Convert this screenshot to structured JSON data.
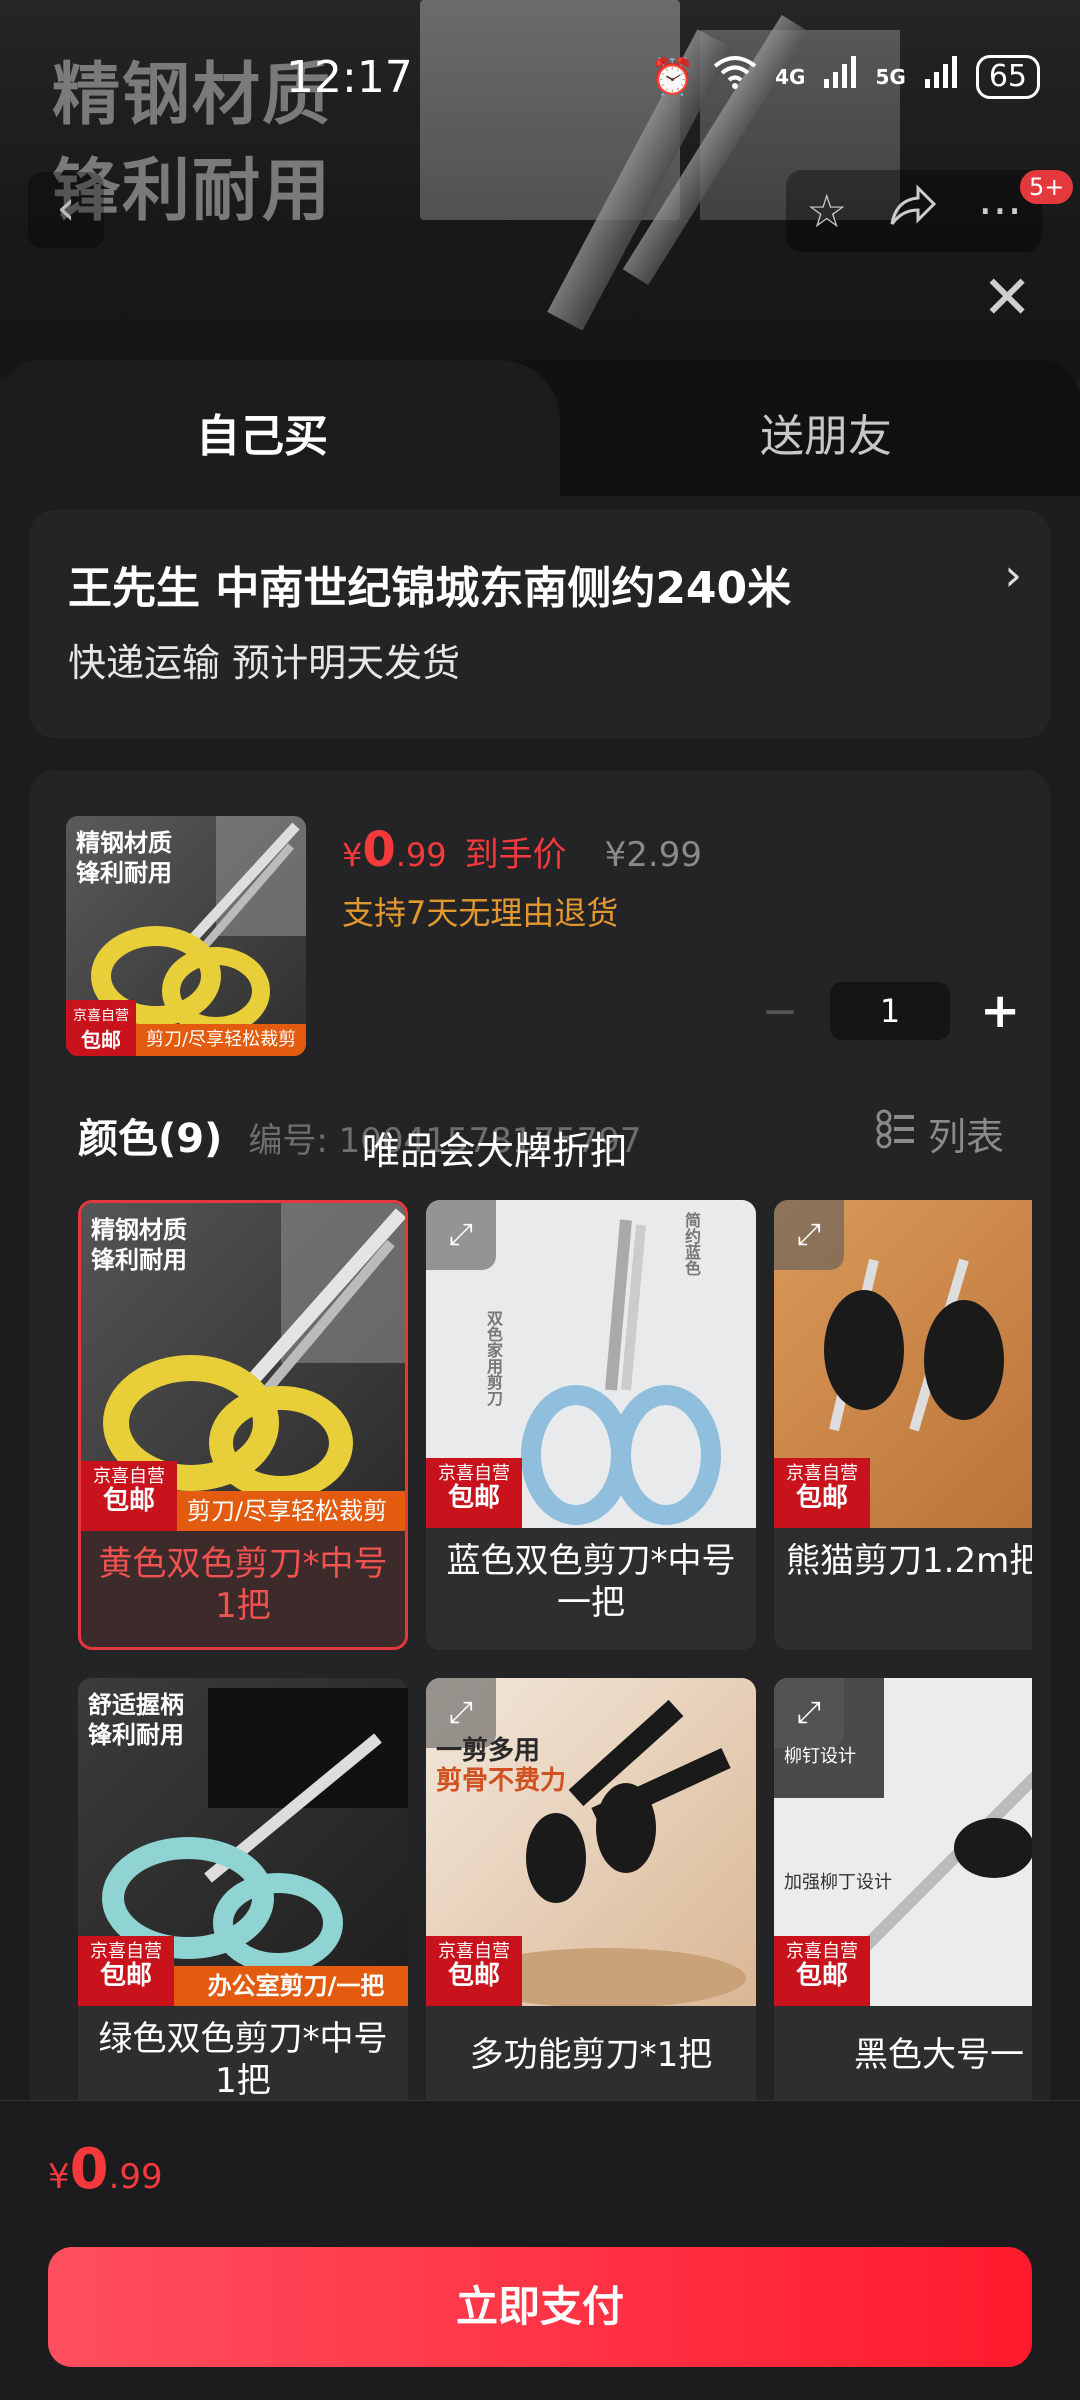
{
  "status_bar": {
    "time": "12:17",
    "network_1": "4G",
    "network_2": "5G",
    "battery": "65"
  },
  "hero": {
    "title_line1": "精钢材质",
    "title_line2": "锋利耐用",
    "badge": "5+"
  },
  "tabs": {
    "self": "自己买",
    "friend": "送朋友"
  },
  "address": {
    "line1": "王先生  中南世纪锦城东南侧约240米",
    "line2": "快递运输 预计明天发货"
  },
  "product": {
    "price_currency": "¥",
    "price_int": "0",
    "price_dec": ".99",
    "price_tag": "到手价",
    "orig_price": "¥2.99",
    "return_note": "支持7天无理由退货",
    "thumb_caption1": "精钢材质",
    "thumb_caption2": "锋利耐用",
    "thumb_strip": "剪刀/尽享轻松裁剪",
    "quantity": "1",
    "qty_minus": "−",
    "qty_plus": "+"
  },
  "color_section": {
    "title": "颜色(9)",
    "code_label": "编号: 10041578175797",
    "list_toggle": "列表",
    "overlay_toast": "唯品会大牌折扣"
  },
  "jd_badge": {
    "top": "京喜自营",
    "bottom": "包邮"
  },
  "variants": [
    {
      "label": "黄色双色剪刀*中号1把",
      "caption1": "精钢材质",
      "caption2": "锋利耐用",
      "strip": "剪刀/尽享轻松裁剪"
    },
    {
      "label": "蓝色双色剪刀*中号一把",
      "caption1": "双色家用剪刀",
      "caption2": "简约蓝色",
      "strip": ""
    },
    {
      "label": "熊猫剪刀1.2m把",
      "caption1": "",
      "caption2": "",
      "strip": ""
    },
    {
      "label": "绿色双色剪刀*中号1把",
      "caption1": "舒适握柄",
      "caption2": "锋利耐用",
      "strip": "办公室剪刀/一把"
    },
    {
      "label": "多功能剪刀*1把",
      "caption1": "一剪多用",
      "caption2": "剪骨不费力",
      "strip": ""
    },
    {
      "label": "黑色大号一",
      "caption1": "柳钉设计",
      "caption2": "加强柳丁设计",
      "strip": ""
    }
  ],
  "bottom": {
    "price_currency": "¥",
    "price_int": "0",
    "price_dec": ".99",
    "pay_button": "立即支付"
  },
  "colors": {
    "accent": "#f5393c",
    "pay_gradient_start": "#ff4f5f",
    "pay_gradient_end": "#ff1a2d",
    "return_text": "#e2982e",
    "jd_red": "#c8121c"
  }
}
